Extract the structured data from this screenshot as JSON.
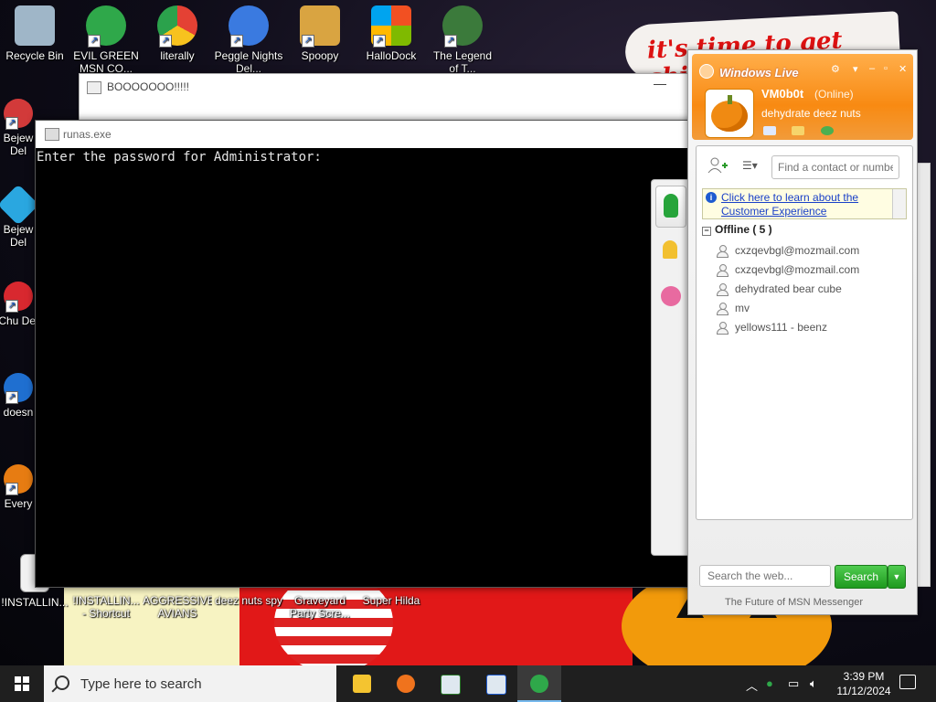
{
  "wallpaper": {
    "banner_text": "it's time to get shit"
  },
  "desktop_icons_top": [
    {
      "label": "Recycle Bin",
      "icon": "recycle-bin-icon",
      "color": "#9fb6c8"
    },
    {
      "label": "EVIL GREEN MSN CO...",
      "icon": "msn-buddy-icon",
      "color": "#2fa84a"
    },
    {
      "label": "literally",
      "icon": "chrome-icon",
      "color": "#e44134"
    },
    {
      "label": "Peggle Nights Del...",
      "icon": "peggle-icon",
      "color": "#3a7ae0"
    },
    {
      "label": "Spoopy",
      "icon": "spoopy-icon",
      "color": "#d9a441"
    },
    {
      "label": "HalloDock",
      "icon": "hallodock-icon",
      "color": "#1e88e5"
    },
    {
      "label": "The Legend of T...",
      "icon": "legend-game-icon",
      "color": "#3b7a3b"
    }
  ],
  "desktop_icons_left": [
    {
      "label": "Bejew Del",
      "icon": "bejeweled-icon",
      "color": "#d23a3a"
    },
    {
      "label": "Bejew Del",
      "icon": "bejeweled-diamond-icon",
      "color": "#2aa7e0"
    },
    {
      "label": "Chu Del",
      "icon": "chuzzle-icon",
      "color": "#d8282f"
    },
    {
      "label": "doesn",
      "icon": "app-icon",
      "color": "#1f6fd0"
    },
    {
      "label": "Every",
      "icon": "app-orange-icon",
      "color": "#e77c12"
    }
  ],
  "desktop_icons_bottom": [
    {
      "label": "!INSTALLIN...",
      "icon": "document-icon"
    },
    {
      "label": "!INSTALLIN... - Shortcut",
      "icon": "document-shortcut-icon"
    },
    {
      "label": "AGGRESSIVE AVIANS",
      "icon": "game-icon"
    },
    {
      "label": "deez nuts spy",
      "icon": "game-icon"
    },
    {
      "label": "Graveyard Party Scre...",
      "icon": "game-icon"
    },
    {
      "label": "Super Hilda",
      "icon": "game-icon"
    }
  ],
  "boo_window": {
    "title": "BOOOOOOO!!!!!",
    "minimize": "—"
  },
  "runas": {
    "title": "runas.exe",
    "console_text": "Enter the password for Administrator:"
  },
  "messenger": {
    "brand": "Windows Live",
    "user": {
      "name": "VM0b0t",
      "status": "(Online)",
      "personal_message": "dehydrate deez nuts"
    },
    "search_contact_placeholder": "Find a contact or number",
    "notice": "Click here to learn about the Customer Experience",
    "group_label": "Offline ( 5 )",
    "contacts": [
      "cxzqevbgl@mozmail.com",
      "cxzqevbgl@mozmail.com",
      "dehydrated bear cube",
      "mv",
      "yellows111 - beenz"
    ],
    "web_search_placeholder": "Search the web...",
    "search_button": "Search",
    "footer": "The Future of MSN Messenger"
  },
  "taskbar": {
    "search_placeholder": "Type here to search",
    "time": "3:39 PM",
    "date": "11/12/2024",
    "colors": {
      "accent": "#76b9ed"
    }
  }
}
